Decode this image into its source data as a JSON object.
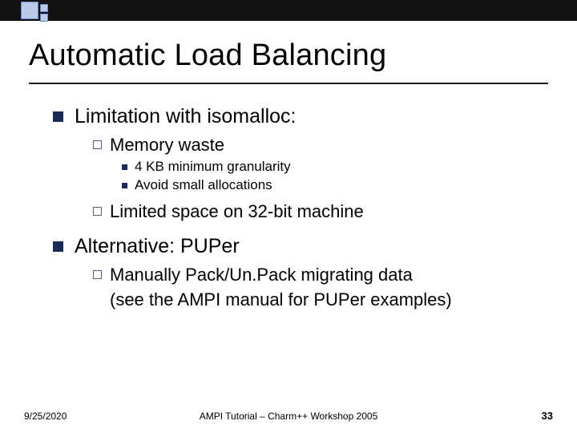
{
  "title": "Automatic Load Balancing",
  "bullets": {
    "b1": {
      "text": "Limitation with isomalloc:"
    },
    "b1_1": {
      "text": "Memory waste"
    },
    "b1_1_1": {
      "text": "4 KB minimum granularity"
    },
    "b1_1_2": {
      "text": "Avoid small allocations"
    },
    "b1_2": {
      "text": "Limited space on 32-bit machine"
    },
    "b2": {
      "text": "Alternative: PUPer"
    },
    "b2_1": {
      "text": "Manually Pack/Un.Pack migrating data"
    },
    "b2_1_body": {
      "text": "(see the AMPI manual for PUPer examples)"
    }
  },
  "footer": {
    "date": "9/25/2020",
    "center": "AMPI Tutorial – Charm++ Workshop 2005",
    "page": "33"
  }
}
